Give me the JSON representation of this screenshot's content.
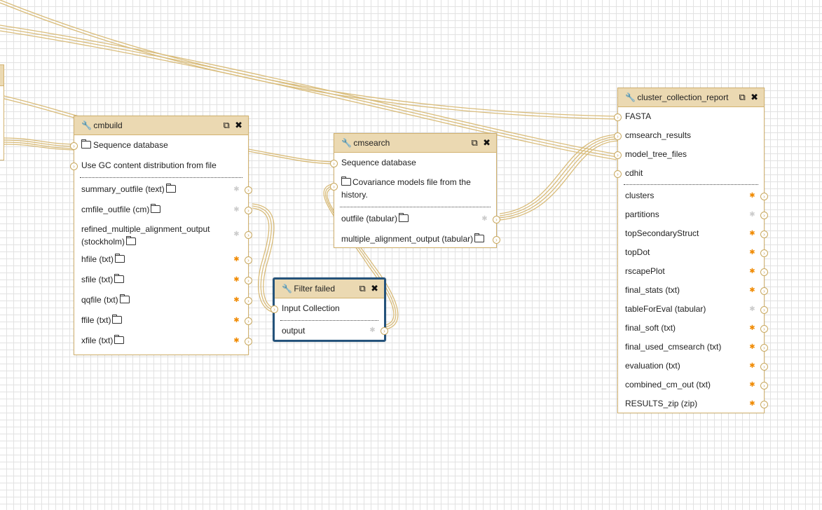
{
  "nodes": {
    "cmbuild": {
      "title": "cmbuild",
      "inputs": [
        "Sequence database",
        "Use GC content distribution from file"
      ],
      "outputs": [
        "summary_outfile (text)",
        "cmfile_outfile (cm)",
        "refined_multiple_alignment_output (stockholm)",
        "hfile (txt)",
        "sfile (txt)",
        "qqfile (txt)",
        "ffile (txt)",
        "xfile (txt)"
      ]
    },
    "cmsearch": {
      "title": "cmsearch",
      "inputs": [
        "Sequence database",
        "Covariance models file from the history."
      ],
      "outputs": [
        "outfile (tabular)",
        "multiple_alignment_output (tabular)"
      ]
    },
    "filter_failed": {
      "title": "Filter failed",
      "inputs": [
        "Input Collection"
      ],
      "outputs": [
        "output"
      ]
    },
    "cluster_collection_report": {
      "title": "cluster_collection_report",
      "inputs": [
        "FASTA",
        "cmsearch_results",
        "model_tree_files",
        "cdhit"
      ],
      "outputs": [
        "clusters",
        "partitions",
        "topSecondaryStruct",
        "topDot",
        "rscapePlot",
        "final_stats (txt)",
        "tableForEval (tabular)",
        "final_soft (txt)",
        "final_used_cmsearch (txt)",
        "evaluation (txt)",
        "combined_cm_out (txt)",
        "RESULTS_zip (zip)"
      ]
    }
  },
  "icons": {
    "wrench": "🔧",
    "copy": "⧉",
    "close": "✖",
    "terminal": "›",
    "asterisk": "✱"
  },
  "colors": {
    "header_bg": "#ebd9b2",
    "border": "#d2b26f",
    "wire": "#d9bc7a",
    "selected_border": "#25537b",
    "active_output": "#f08a00"
  }
}
